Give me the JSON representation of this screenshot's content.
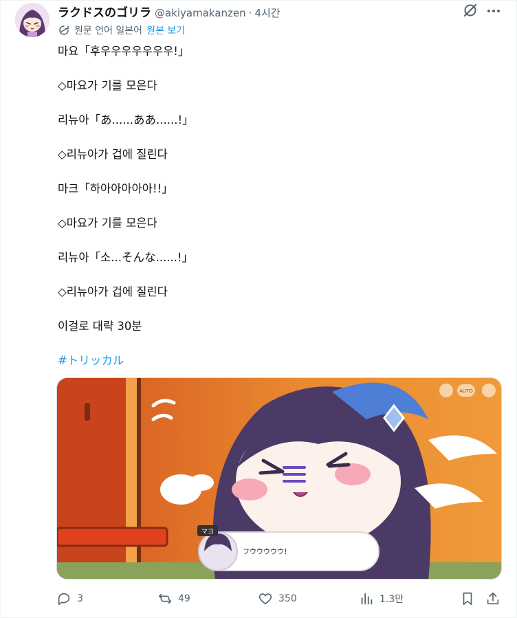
{
  "post": {
    "display_name": "ラクドスのゴリラ",
    "handle": "@akiyamakanzen",
    "separator": "·",
    "time": "4시간",
    "translation_note": "원문 언어 일본어",
    "view_original": "원본 보기",
    "lines": [
      "마요「후우우우우우우우!」",
      "◇마요가 기를 모은다",
      "리뉴아「あ......ああ......!」",
      "◇리뉴아가 겁에 질린다",
      "마크「하아아아아아!!」",
      "◇마요가 기를 모은다",
      "리뉴아「소...そんな......!」",
      "◇리뉴아가 겁에 질린다",
      "이걸로 대략 30분"
    ],
    "hashtag": "#トリッカル",
    "icons": {
      "avatar": "avatar-image",
      "grok": "grok-icon",
      "more": "more-icon",
      "translate": "translate-icon"
    }
  },
  "media": {
    "speaker_tag": "マヨ",
    "dialogue": "フウウウウウ！",
    "auto_label": "AUTO"
  },
  "actions": {
    "replies": "3",
    "reposts": "49",
    "likes": "350",
    "views": "1.3만"
  },
  "colors": {
    "link": "#1d9bf0",
    "secondary_text": "#536471",
    "primary_text": "#0f1419"
  }
}
